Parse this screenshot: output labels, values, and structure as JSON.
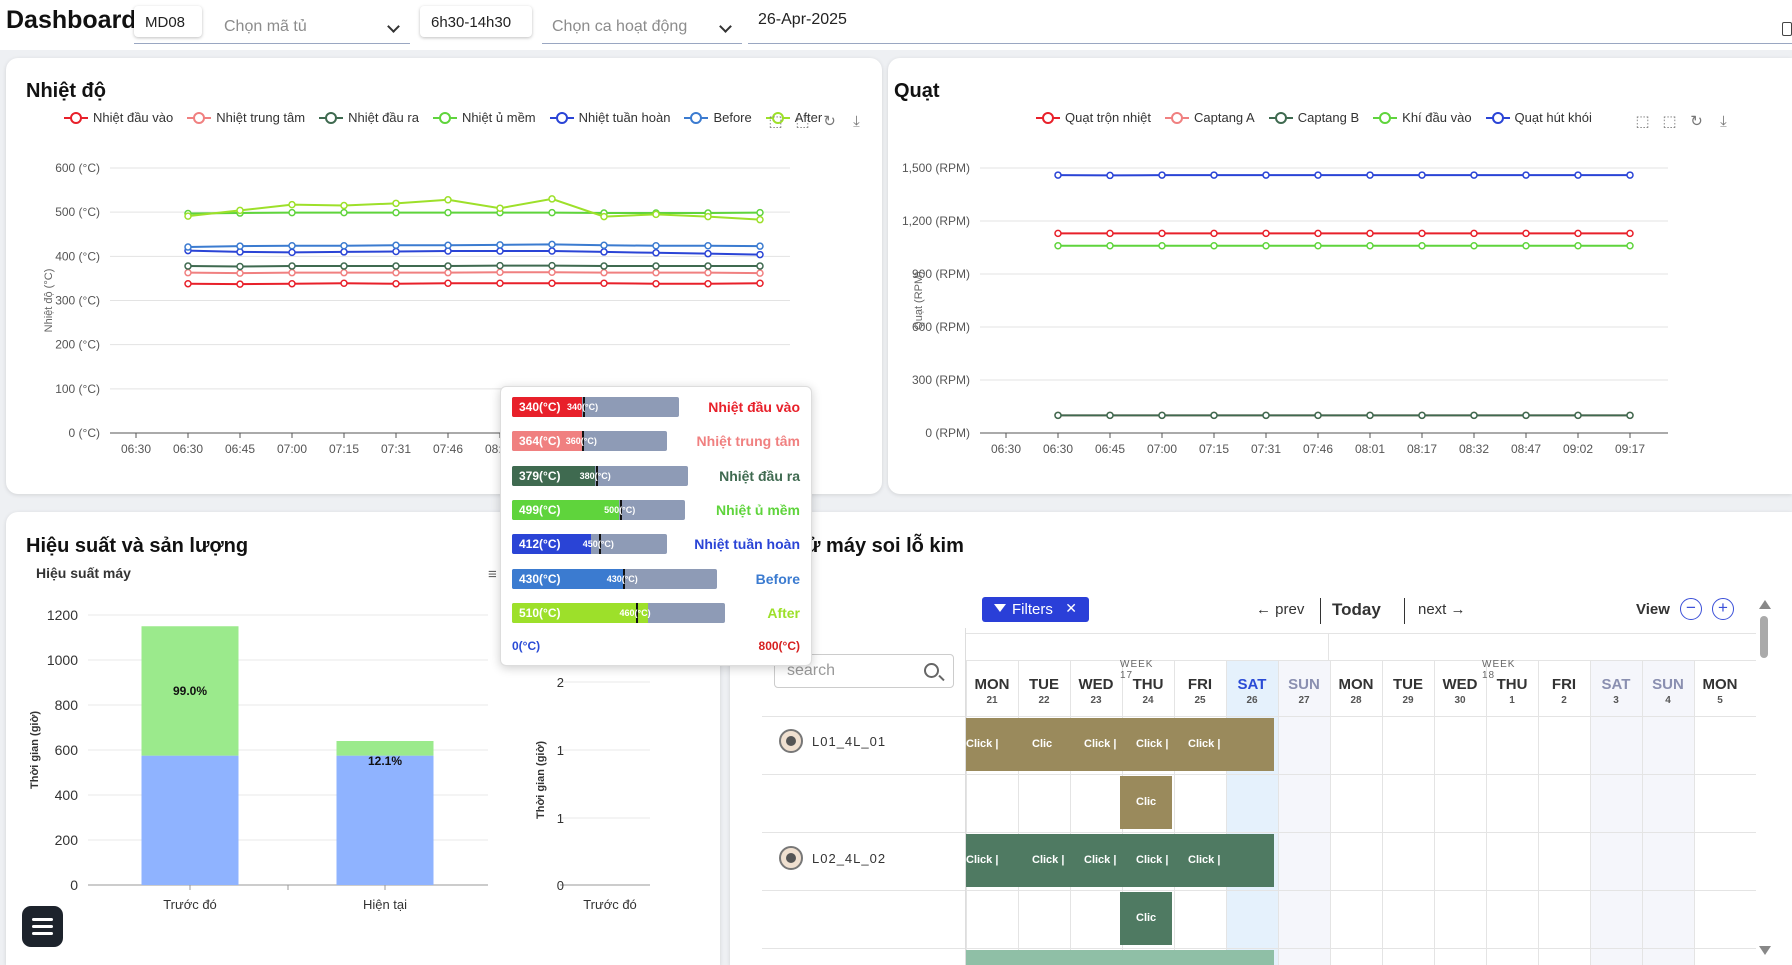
{
  "header": {
    "title": "Dashboard",
    "machine_code": "MD08",
    "cabinet_placeholder": "Chọn mã tủ",
    "shift": "6h30-14h30",
    "shift_placeholder": "Chọn ca hoạt động",
    "date": "26-Apr-2025"
  },
  "temp_chart": {
    "title": "Nhiệt độ",
    "ylabel": "Nhiệt độ (°C)",
    "legend": [
      {
        "name": "Nhiệt đầu vào",
        "color": "#e8202a"
      },
      {
        "name": "Nhiệt trung tâm",
        "color": "#f08080"
      },
      {
        "name": "Nhiệt đầu ra",
        "color": "#3f6a50"
      },
      {
        "name": "Nhiệt ủ mềm",
        "color": "#5fd43c"
      },
      {
        "name": "Nhiệt tuần hoàn",
        "color": "#2a44d6"
      },
      {
        "name": "Before",
        "color": "#3b7bd0"
      },
      {
        "name": "After",
        "color": "#9de02a"
      }
    ],
    "toolbar_icons": [
      "zoom-icon",
      "zoom-reset-icon",
      "restore-icon",
      "download-icon"
    ]
  },
  "fan_chart": {
    "title": "Quạt",
    "ylabel": "Quạt (RPM)",
    "legend": [
      {
        "name": "Quạt trộn nhiệt",
        "color": "#e8202a"
      },
      {
        "name": "Captang A",
        "color": "#f08080"
      },
      {
        "name": "Captang B",
        "color": "#3f6a50"
      },
      {
        "name": "Khí đầu vào",
        "color": "#5fd43c"
      },
      {
        "name": "Quạt hút khói",
        "color": "#2a44d6"
      }
    ],
    "toolbar_icons": [
      "zoom-icon",
      "zoom-reset-icon",
      "restore-icon",
      "download-icon"
    ]
  },
  "chart_data": [
    {
      "type": "line",
      "title": "Nhiệt độ",
      "ylabel": "Nhiệt độ (°C)",
      "ylim": [
        0,
        600
      ],
      "yticks": [
        "0 (°C)",
        "100 (°C)",
        "200 (°C)",
        "300 (°C)",
        "400 (°C)",
        "500 (°C)",
        "600 (°C)"
      ],
      "x": [
        "06:30",
        "06:30",
        "06:45",
        "07:00",
        "07:15",
        "07:31",
        "07:46",
        "08:01"
      ],
      "x_points": 12,
      "series": [
        {
          "name": "Nhiệt đầu vào",
          "color": "#e8202a",
          "values": [
            338,
            337,
            338,
            339,
            338,
            339,
            339,
            339,
            339,
            338,
            338,
            339
          ]
        },
        {
          "name": "Nhiệt trung tâm",
          "color": "#f08080",
          "values": [
            363,
            362,
            363,
            363,
            363,
            363,
            364,
            364,
            363,
            363,
            363,
            362
          ]
        },
        {
          "name": "Nhiệt đầu ra",
          "color": "#3f6a50",
          "values": [
            378,
            377,
            378,
            378,
            378,
            378,
            379,
            379,
            378,
            378,
            378,
            378
          ]
        },
        {
          "name": "Nhiệt ủ mềm",
          "color": "#5fd43c",
          "values": [
            497,
            498,
            499,
            499,
            499,
            499,
            499,
            499,
            498,
            498,
            498,
            499
          ]
        },
        {
          "name": "Nhiệt tuần hoàn",
          "color": "#2a44d6",
          "values": [
            413,
            410,
            409,
            410,
            411,
            412,
            412,
            412,
            410,
            408,
            406,
            404
          ]
        },
        {
          "name": "Before",
          "color": "#3b7bd0",
          "values": [
            421,
            423,
            424,
            424,
            425,
            425,
            426,
            427,
            425,
            424,
            424,
            423
          ]
        },
        {
          "name": "After",
          "color": "#9de02a",
          "values": [
            491,
            504,
            517,
            515,
            520,
            528,
            509,
            530,
            490,
            495,
            490,
            483
          ]
        }
      ]
    },
    {
      "type": "line",
      "title": "Quạt",
      "ylabel": "Quạt (RPM)",
      "ylim": [
        0,
        1500
      ],
      "yticks": [
        "0 (RPM)",
        "300 (RPM)",
        "600 (RPM)",
        "900 (RPM)",
        "1,200 (RPM)",
        "1,500 (RPM)"
      ],
      "x": [
        "06:30",
        "06:30",
        "06:45",
        "07:00",
        "07:15",
        "07:31",
        "07:46",
        "08:01",
        "08:17",
        "08:32",
        "08:47",
        "09:02",
        "09:17"
      ],
      "x_points": 12,
      "series": [
        {
          "name": "Quạt trộn nhiệt",
          "color": "#e8202a",
          "values": [
            1130,
            1130,
            1130,
            1130,
            1130,
            1130,
            1130,
            1130,
            1130,
            1130,
            1130,
            1130
          ]
        },
        {
          "name": "Captang A",
          "color": "#f08080",
          "values": [
            100,
            100,
            100,
            100,
            100,
            100,
            100,
            100,
            100,
            100,
            100,
            100
          ]
        },
        {
          "name": "Captang B",
          "color": "#3f6a50",
          "values": [
            100,
            100,
            100,
            100,
            100,
            100,
            100,
            100,
            100,
            100,
            100,
            100
          ]
        },
        {
          "name": "Khí đầu vào",
          "color": "#5fd43c",
          "values": [
            1060,
            1060,
            1060,
            1060,
            1060,
            1060,
            1060,
            1060,
            1060,
            1060,
            1060,
            1060
          ]
        },
        {
          "name": "Quạt hút khói",
          "color": "#2a44d6",
          "values": [
            1460,
            1458,
            1460,
            1460,
            1460,
            1460,
            1460,
            1460,
            1460,
            1460,
            1460,
            1460
          ]
        }
      ]
    },
    {
      "type": "bar",
      "title": "Hiệu suất máy",
      "ylabel": "Thời gian (giờ)",
      "ylim": [
        0,
        1200
      ],
      "yticks": [
        "0",
        "200",
        "400",
        "600",
        "800",
        "1000",
        "1200"
      ],
      "categories": [
        "Trước đó",
        "Hiện tại"
      ],
      "series": [
        {
          "values": [
            575,
            575
          ],
          "color": "#8fb3ff"
        },
        {
          "values": [
            575,
            65
          ],
          "color": "#9bea8c"
        }
      ],
      "data_labels": [
        "99.0%",
        "12.1%"
      ]
    },
    {
      "type": "bar",
      "ylabel": "Thời gian (giờ)",
      "yticks": [
        "0",
        "1",
        "1",
        "2"
      ],
      "categories": [
        "Trước đó"
      ]
    }
  ],
  "tooltip": {
    "min_label": "0(°C)",
    "max_label": "800(°C)",
    "rows": [
      {
        "name": "Nhiệt đầu vào",
        "value": "340(°C)",
        "mini": "340(°C)",
        "color": "#e8202a",
        "fill": 0.42,
        "tick": 0.425,
        "bar_w": 167
      },
      {
        "name": "Nhiệt trung tâm",
        "value": "364(°C)",
        "mini": "360(°C)",
        "color": "#f08080",
        "fill": 0.45,
        "tick": 0.45,
        "bar_w": 155
      },
      {
        "name": "Nhiệt đầu ra",
        "value": "379(°C)",
        "mini": "380(°C)",
        "color": "#3f6a50",
        "fill": 0.47,
        "tick": 0.475,
        "bar_w": 176
      },
      {
        "name": "Nhiệt ủ mềm",
        "value": "499(°C)",
        "mini": "500(°C)",
        "color": "#5fd43c",
        "fill": 0.62,
        "tick": 0.625,
        "bar_w": 173
      },
      {
        "name": "Nhiệt tuần hoàn",
        "value": "412(°C)",
        "mini": "450(°C)",
        "color": "#2a44d6",
        "fill": 0.51,
        "tick": 0.56,
        "bar_w": 155
      },
      {
        "name": "Before",
        "value": "430(°C)",
        "mini": "430(°C)",
        "color": "#3b7bd0",
        "fill": 0.54,
        "tick": 0.54,
        "bar_w": 205
      },
      {
        "name": "After",
        "value": "510(°C)",
        "mini": "460(°C)",
        "color": "#9de02a",
        "fill": 0.64,
        "tick": 0.58,
        "bar_w": 213
      }
    ]
  },
  "performance": {
    "title": "Hiệu suất và sản lượng",
    "subtitle": "Hiệu suất máy"
  },
  "schedule": {
    "title_visible": "ử máy soi lỗ kim",
    "filters_label": "Filters",
    "prev_label": "← prev",
    "today_label": "Today",
    "next_label": "next →",
    "view_label": "View",
    "search_placeholder": "search",
    "weeks": [
      "WEEK 17",
      "WEEK 18"
    ],
    "days": [
      {
        "name": "MON",
        "date": "21"
      },
      {
        "name": "TUE",
        "date": "22"
      },
      {
        "name": "WED",
        "date": "23"
      },
      {
        "name": "THU",
        "date": "24"
      },
      {
        "name": "FRI",
        "date": "25"
      },
      {
        "name": "SAT",
        "date": "26"
      },
      {
        "name": "SUN",
        "date": "27"
      },
      {
        "name": "MON",
        "date": "28"
      },
      {
        "name": "TUE",
        "date": "29"
      },
      {
        "name": "WED",
        "date": "30"
      },
      {
        "name": "THU",
        "date": "1"
      },
      {
        "name": "FRI",
        "date": "2"
      },
      {
        "name": "SAT",
        "date": "3"
      },
      {
        "name": "SUN",
        "date": "4"
      },
      {
        "name": "MON",
        "date": "5"
      }
    ],
    "resources": [
      "L01_4L_01",
      "L02_4L_02"
    ],
    "event_labels": [
      "Click |",
      "Clic",
      "Click |",
      "Click |",
      "Click |",
      "Clic"
    ],
    "event_colors": [
      "#9a8a5c",
      "#4f7a62",
      "#8fbfa6"
    ]
  }
}
